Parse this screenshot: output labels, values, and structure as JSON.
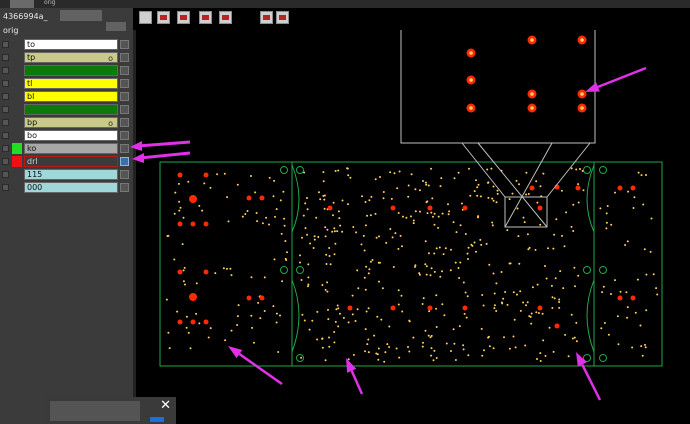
{
  "window": {
    "job_name": "4366994a",
    "step_name": "orig",
    "tab_label": "orig"
  },
  "layers": [
    {
      "name": "to",
      "color": "#ffffff",
      "mark": "",
      "active": false
    },
    {
      "name": "tp",
      "color": "#c9c98a",
      "mark": "o",
      "active": false
    },
    {
      "name": "ts",
      "color": "#0a7a0a",
      "mark": "",
      "active": false
    },
    {
      "name": "tl",
      "color": "#ffff00",
      "mark": "",
      "active": false
    },
    {
      "name": "bl",
      "color": "#ffff00",
      "mark": "",
      "active": false
    },
    {
      "name": "bs",
      "color": "#0a7a0a",
      "mark": "",
      "active": false
    },
    {
      "name": "bp",
      "color": "#c9c98a",
      "mark": "o",
      "active": false
    },
    {
      "name": "bo",
      "color": "#ffffff",
      "mark": "",
      "active": false
    },
    {
      "name": "ko",
      "color": "#a8a8a8",
      "mark": "",
      "swatch": "#22dd22",
      "active": false
    },
    {
      "name": "drl",
      "color": "#3b3b3b",
      "mark": "",
      "swatch": "#ee1111",
      "active": true
    },
    {
      "name": "115",
      "color": "#9fd7da",
      "mark": "",
      "active": false
    },
    {
      "name": "000",
      "color": "#9fd7da",
      "mark": "",
      "active": false
    }
  ],
  "toolbar": {
    "icons": [
      "save-icon",
      "layer-tool-1-icon",
      "layer-tool-2-icon",
      "layer-tool-3-icon",
      "layer-tool-4-icon",
      "layer-tool-5-icon",
      "layer-tool-6-icon"
    ]
  },
  "colors": {
    "board_outline": "#1fa84a",
    "drill_hole": "#ff2a00",
    "drill_center": "#ffd060",
    "arrow": "#e030e8",
    "panel_bg": "#3b3b3b"
  },
  "popup": {
    "close_label": "✕"
  }
}
